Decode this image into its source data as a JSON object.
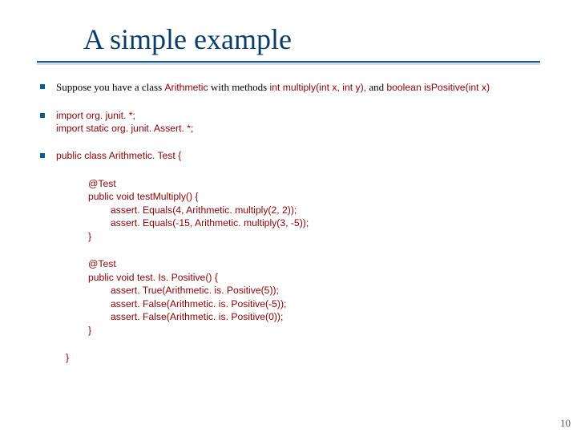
{
  "title": "A simple example",
  "intro": {
    "pre": "Suppose you have a class ",
    "cls": "Arithmetic",
    "mid1": " with methods ",
    "m1": "int multiply(int x, int y),",
    "mid2": "  and ",
    "m2": "boolean isPositive(int x)"
  },
  "imports": {
    "l1": "import org. junit. *;",
    "l2": "import static org. junit. Assert. *;"
  },
  "classdecl": "public class Arithmetic. Test {",
  "test1": {
    "a": "@Test",
    "b": "public void testMultiply() {",
    "c": "assert. Equals(4, Arithmetic. multiply(2, 2));",
    "d": "assert. Equals(-15, Arithmetic. multiply(3, -5));",
    "e": "}"
  },
  "test2": {
    "a": "@Test",
    "b": "public void test. Is. Positive() {",
    "c": "assert. True(Arithmetic. is. Positive(5));",
    "d": "assert. False(Arithmetic. is. Positive(-5));",
    "e": "assert. False(Arithmetic. is. Positive(0));",
    "f": "}"
  },
  "close": "}",
  "page": "10"
}
